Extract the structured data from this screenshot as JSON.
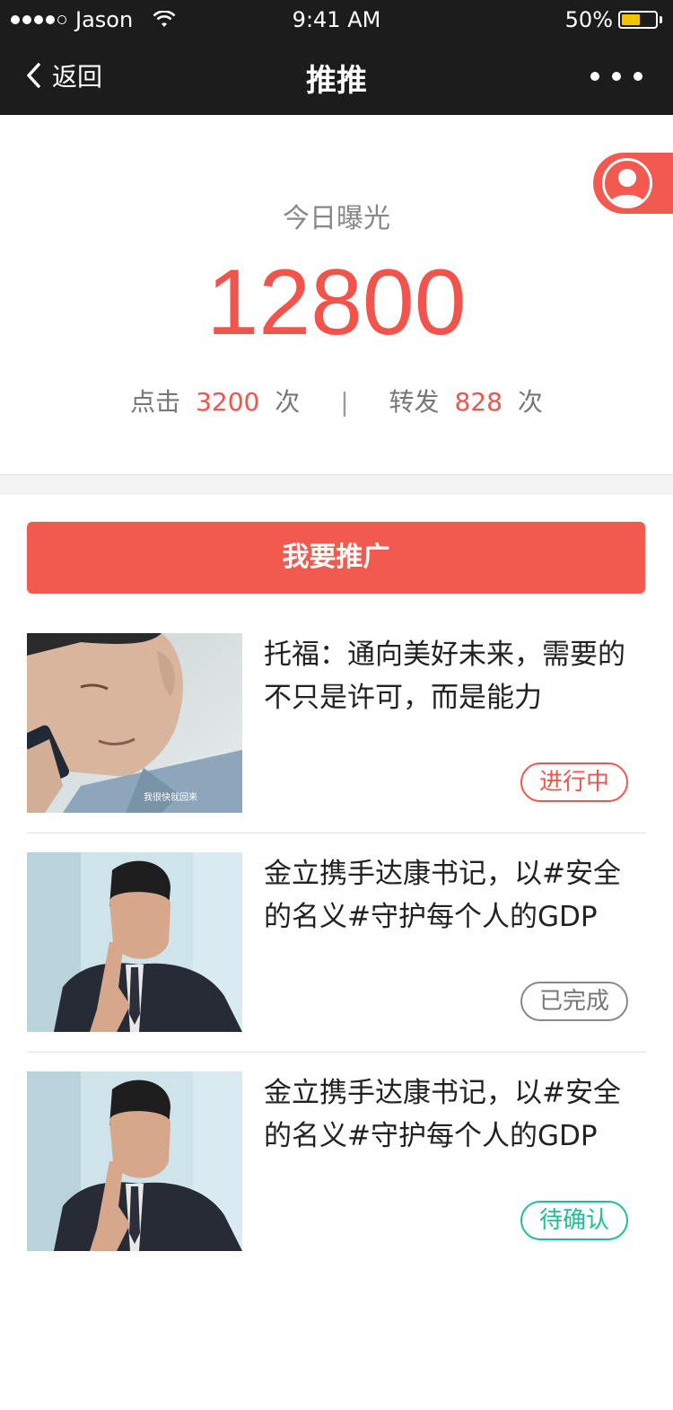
{
  "status_bar": {
    "carrier": "Jason",
    "time": "9:41 AM",
    "battery": "50%"
  },
  "nav": {
    "back_label": "返回",
    "title": "推推"
  },
  "stats": {
    "label": "今日曝光",
    "value": "12800",
    "clicks_label": "点击",
    "clicks_value": "3200",
    "clicks_unit": "次",
    "separator": "|",
    "shares_label": "转发",
    "shares_value": "828",
    "shares_unit": "次"
  },
  "promote_button": "我要推广",
  "items": [
    {
      "title": "托福：通向美好未来，需要的不只是许可，而是能力",
      "status": "进行中",
      "thumb_caption": "我很快就回来"
    },
    {
      "title": "金立携手达康书记，以#安全的名义#守护每个人的GDP",
      "status": "已完成"
    },
    {
      "title": "金立携手达康书记，以#安全的名义#守护每个人的GDP",
      "status": "待确认"
    }
  ],
  "colors": {
    "accent": "#f25a50",
    "nav_bg": "#1c1c1c",
    "pending": "#1bbf97",
    "done": "#777777"
  }
}
